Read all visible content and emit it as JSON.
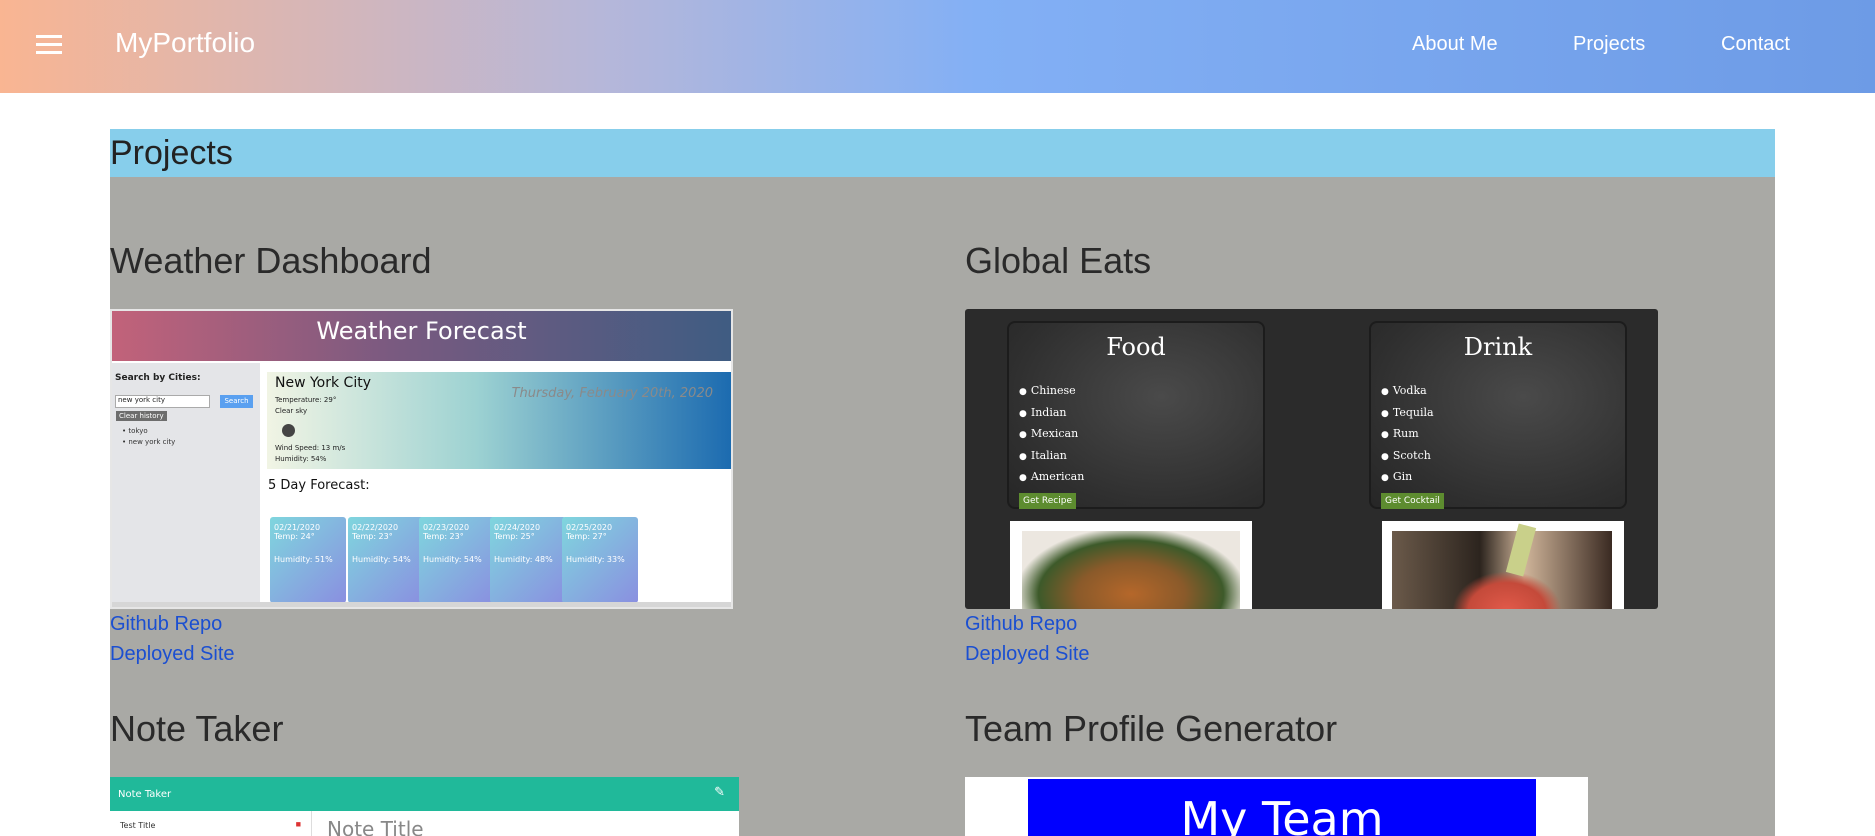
{
  "nav": {
    "brand": "MyPortfolio",
    "links": [
      "About Me",
      "Projects",
      "Contact"
    ],
    "colors": {
      "gradient_start": "#f9b592",
      "gradient_mid": "#83b0f5",
      "gradient_end": "#6d9be6"
    }
  },
  "section": {
    "title": "Projects",
    "header_color": "#87ceeb",
    "body_color": "#a9a9a5"
  },
  "projects": [
    {
      "title": "Weather Dashboard",
      "links": [
        "Github Repo",
        "Deployed Site"
      ],
      "thumbnail": {
        "header": "Weather Forecast",
        "search_label": "Search by Cities:",
        "search_value": "new york city",
        "search_button": "Search",
        "clear_button": "Clear history",
        "history": [
          "tokyo",
          "new york city"
        ],
        "city": "New York City",
        "date": "Thursday, February 20th, 2020",
        "temperature": "Temperature: 29°",
        "sky": "Clear sky",
        "wind": "Wind Speed: 13 m/s",
        "humidity": "Humidity: 54%",
        "forecast_label": "5 Day Forecast:",
        "forecast": [
          {
            "date": "02/21/2020",
            "temp": "Temp: 24°",
            "humidity": "Humidity: 51%"
          },
          {
            "date": "02/22/2020",
            "temp": "Temp: 23°",
            "humidity": "Humidity: 54%"
          },
          {
            "date": "02/23/2020",
            "temp": "Temp: 23°",
            "humidity": "Humidity: 54%"
          },
          {
            "date": "02/24/2020",
            "temp": "Temp: 25°",
            "humidity": "Humidity: 48%"
          },
          {
            "date": "02/25/2020",
            "temp": "Temp: 27°",
            "humidity": "Humidity: 33%"
          }
        ]
      }
    },
    {
      "title": "Global Eats",
      "links": [
        "Github Repo",
        "Deployed Site"
      ],
      "thumbnail": {
        "food_title": "Food",
        "food_items": [
          "Chinese",
          "Indian",
          "Mexican",
          "Italian",
          "American"
        ],
        "food_button": "Get Recipe",
        "drink_title": "Drink",
        "drink_items": [
          "Vodka",
          "Tequila",
          "Rum",
          "Scotch",
          "Gin"
        ],
        "drink_button": "Get Cocktail"
      }
    },
    {
      "title": "Note Taker",
      "thumbnail": {
        "app_name": "Note Taker",
        "list_item": "Test Title",
        "title_placeholder": "Note Title"
      }
    },
    {
      "title": "Team Profile Generator",
      "thumbnail": {
        "banner": "My Team"
      }
    }
  ]
}
